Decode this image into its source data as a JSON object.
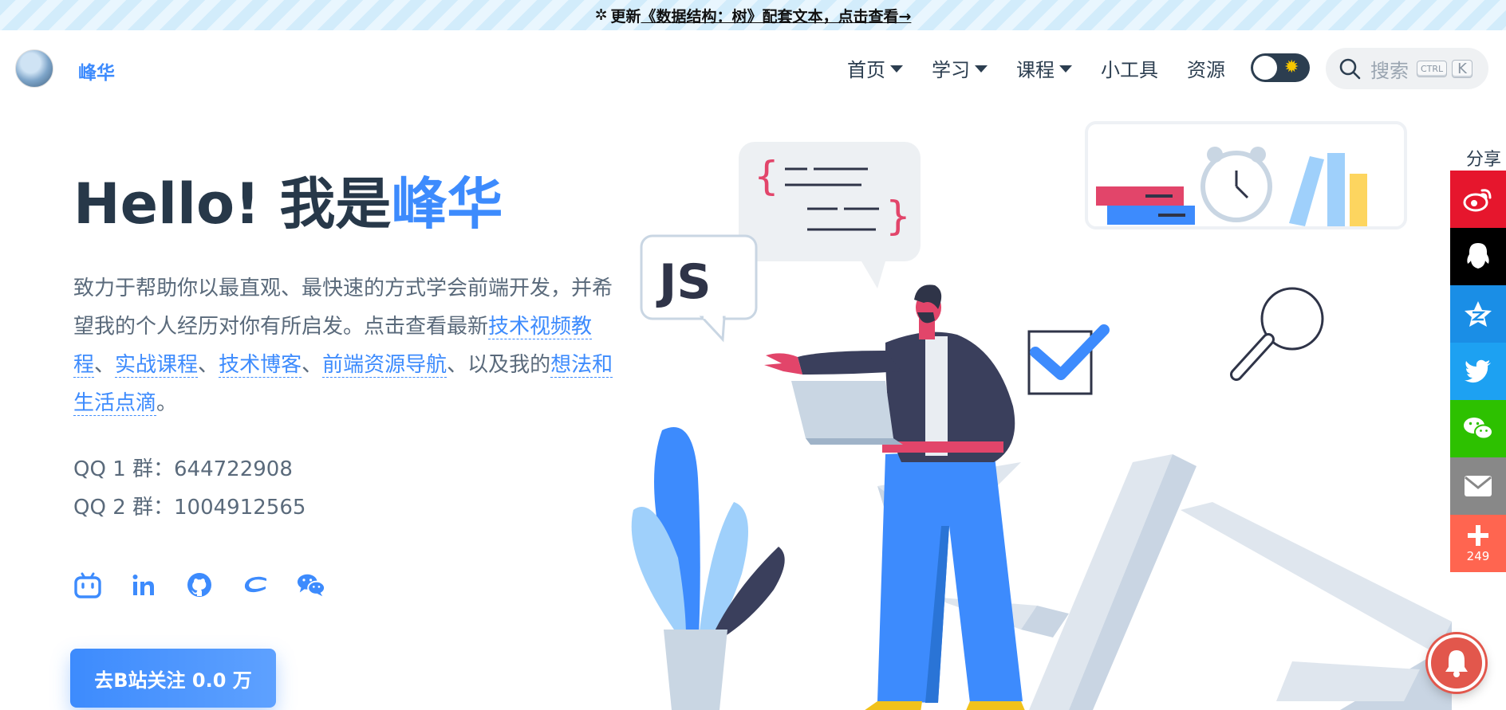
{
  "banner": {
    "prefix": "更新",
    "link": "《数据结构：树》配套文本，点击查看→"
  },
  "header": {
    "site_name": "峰华",
    "nav": [
      {
        "label": "首页",
        "dropdown": true
      },
      {
        "label": "学习",
        "dropdown": true
      },
      {
        "label": "课程",
        "dropdown": true
      },
      {
        "label": "小工具",
        "dropdown": false
      },
      {
        "label": "资源",
        "dropdown": false
      }
    ],
    "search": {
      "placeholder": "搜索",
      "key_ctrl": "CTRL",
      "key_k": "K"
    }
  },
  "hero": {
    "title_prefix": "Hello! 我是",
    "title_highlight": "峰华",
    "intro_1": "致力于帮助你以最直观、最快速的方式学会前端开发，并希望我的个人经历对你有所启发。点击查看最新",
    "link_tech_video": "技术视频教程",
    "sep_1": "、",
    "link_courses": "实战课程",
    "sep_2": "、",
    "link_blog": "技术博客",
    "sep_3": "、",
    "link_nav": "前端资源导航",
    "sep_4": "、以及我的",
    "link_thoughts": "想法和生活点滴",
    "intro_end": "。",
    "qq1": "QQ 1 群：644722908",
    "qq2": "QQ 2 群：1004912565",
    "socials": [
      "bilibili-icon",
      "linkedin-icon",
      "github-icon",
      "juejin-icon",
      "wechat-icon"
    ],
    "cta": "去B站关注 0.0 万"
  },
  "illustration": {
    "js_label": "JS"
  },
  "share": {
    "title": "分享",
    "buttons": [
      "weibo-icon",
      "qq-icon",
      "qzone-icon",
      "twitter-icon",
      "wechat-icon",
      "email-icon",
      "plus-icon"
    ],
    "colors": [
      "#e6162d",
      "#000000",
      "#1a8ee6",
      "#1da1f2",
      "#2dc100",
      "#888888",
      "#ff6550"
    ],
    "count": "249"
  },
  "colors": {
    "accent": "#3d8bfd",
    "title": "#273849"
  }
}
